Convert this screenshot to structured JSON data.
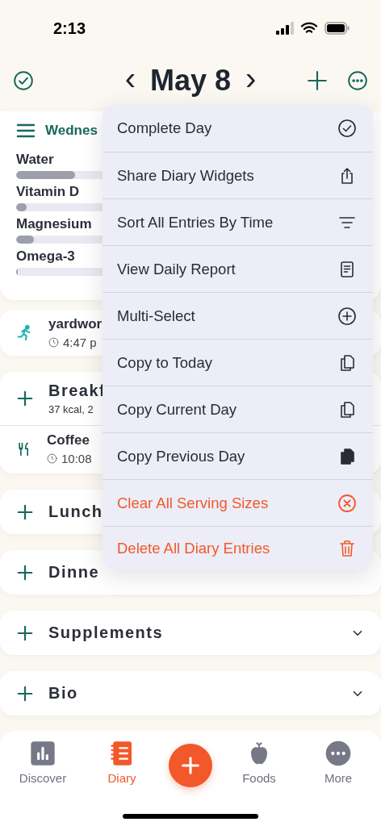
{
  "status_bar": {
    "time": "2:13"
  },
  "header": {
    "title": "May 8",
    "prev": "‹",
    "next": "›"
  },
  "summary_card": {
    "day_label": "Wednes",
    "nutrients": [
      {
        "name": "Water",
        "level": 0.17
      },
      {
        "name": "Vitamin D",
        "level": 0.03
      },
      {
        "name": "Magnesium",
        "level": 0.05
      },
      {
        "name": "Omega-3",
        "level": 0.005
      }
    ]
  },
  "activity": {
    "name": "yardwor",
    "time": "4:47 p"
  },
  "breakfast": {
    "title": "Breakf",
    "summary": "37 kcal, 2",
    "entry": {
      "name": "Coffee",
      "time": "10:08"
    }
  },
  "meals": [
    {
      "title": "Lunch"
    },
    {
      "title": "Dinne"
    },
    {
      "title": "Supplements",
      "chevron": true
    },
    {
      "title": "Bio",
      "chevron": true
    }
  ],
  "menu": {
    "items": [
      {
        "label": "Complete Day",
        "kind": "normal"
      },
      {
        "label": "Share Diary Widgets",
        "kind": "normal"
      },
      {
        "label": "Sort All Entries By Time",
        "kind": "normal"
      },
      {
        "label": "View Daily Report",
        "kind": "normal"
      },
      {
        "label": "Multi-Select",
        "kind": "normal"
      },
      {
        "label": "Copy to Today",
        "kind": "normal"
      },
      {
        "label": "Copy Current Day",
        "kind": "normal"
      },
      {
        "label": "Copy Previous Day",
        "kind": "normal"
      },
      {
        "label": "Clear All Serving Sizes",
        "kind": "destructive"
      },
      {
        "label": "Delete All Diary Entries",
        "kind": "destructive"
      }
    ]
  },
  "tab_bar": {
    "tabs": [
      {
        "label": "Discover",
        "selected": false
      },
      {
        "label": "Diary",
        "selected": true
      },
      {
        "label": "Foods",
        "selected": false
      },
      {
        "label": "More",
        "selected": false
      }
    ]
  }
}
